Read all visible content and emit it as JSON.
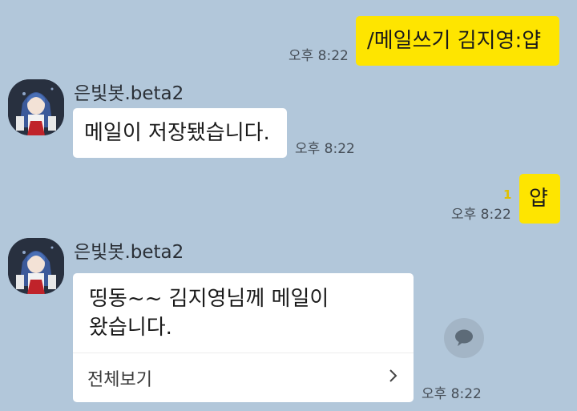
{
  "colors": {
    "background": "#b2c7da",
    "my_bubble": "#fee500",
    "their_bubble": "#ffffff",
    "unread": "#e0c000"
  },
  "messages": [
    {
      "from": "me",
      "text": "/메일쓰기 김지영:얍",
      "time": "오후 8:22"
    },
    {
      "from": "bot",
      "sender": "은빛봇.beta2",
      "text": "메일이 저장됐습니다.",
      "time": "오후 8:22"
    },
    {
      "from": "me",
      "text": "얍",
      "time": "오후 8:22",
      "unread": "1"
    },
    {
      "from": "bot",
      "sender": "은빛봇.beta2",
      "text": "띵동~~ 김지영님께 메일이\n왔습니다.",
      "view_all": "전체보기",
      "time": "오후 8:22"
    }
  ],
  "icons": {
    "avatar": "bot-avatar-icon",
    "share": "speech-bubble-share-icon",
    "chevron": "chevron-right-icon"
  }
}
